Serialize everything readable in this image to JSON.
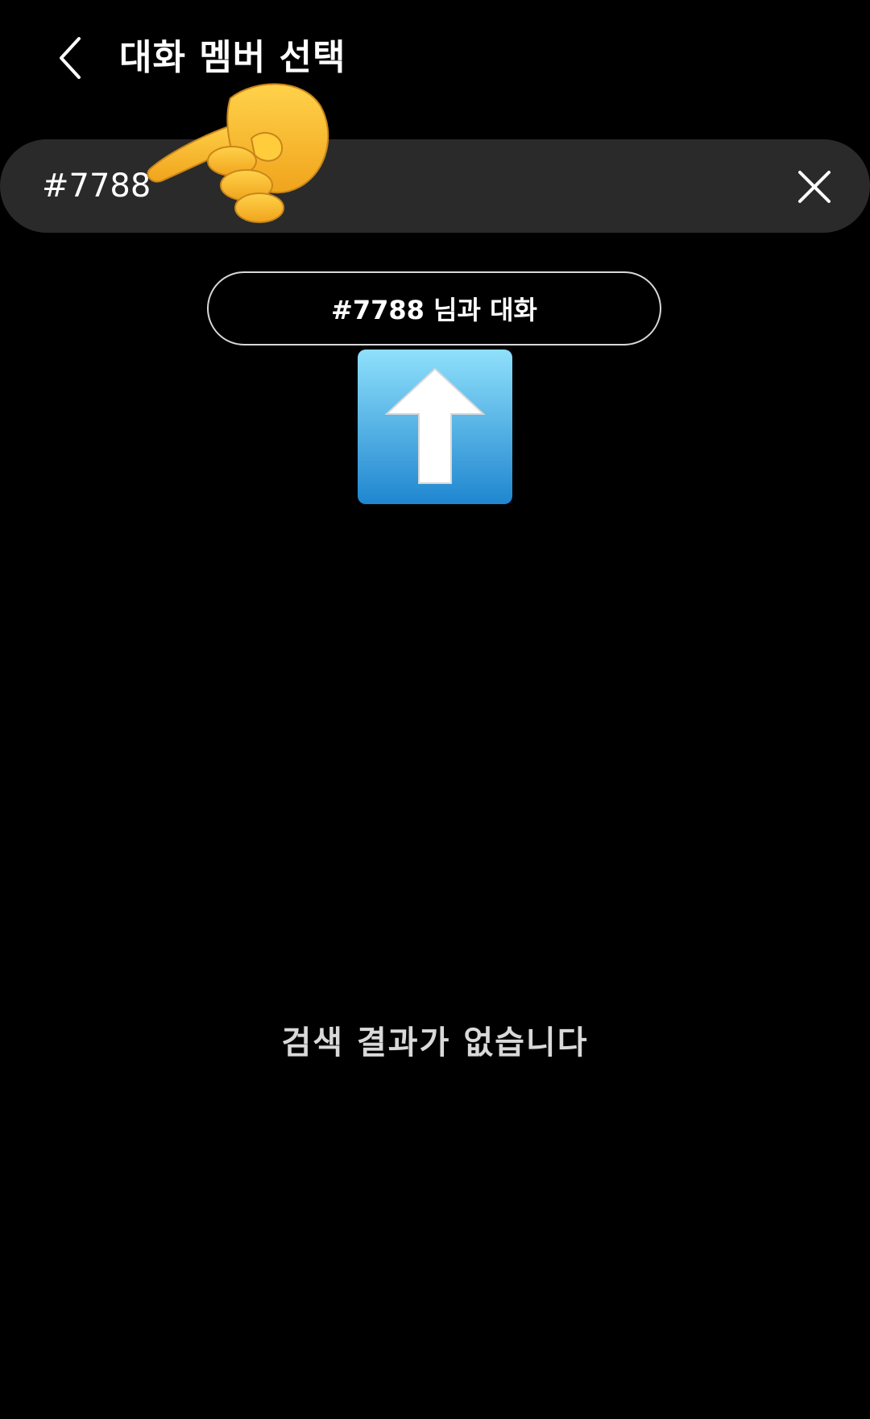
{
  "header": {
    "title": "대화 멤버 선택",
    "back_icon": "chevron-left-icon"
  },
  "search": {
    "value": "#7788",
    "clear_icon": "close-icon"
  },
  "chat_suggestion": {
    "label": "#7788 님과 대화"
  },
  "stickers": {
    "pointer": "pointing-hand-icon",
    "arrow": "up-arrow-icon"
  },
  "results": {
    "empty_message": "검색 결과가 없습니다"
  },
  "colors": {
    "background": "#000000",
    "search_bar": "#2a2a2a",
    "text": "#ffffff",
    "muted_text": "#d9d9d9",
    "arrow_blue": "#3aa3e3",
    "hand_yellow": "#f6b82a"
  }
}
